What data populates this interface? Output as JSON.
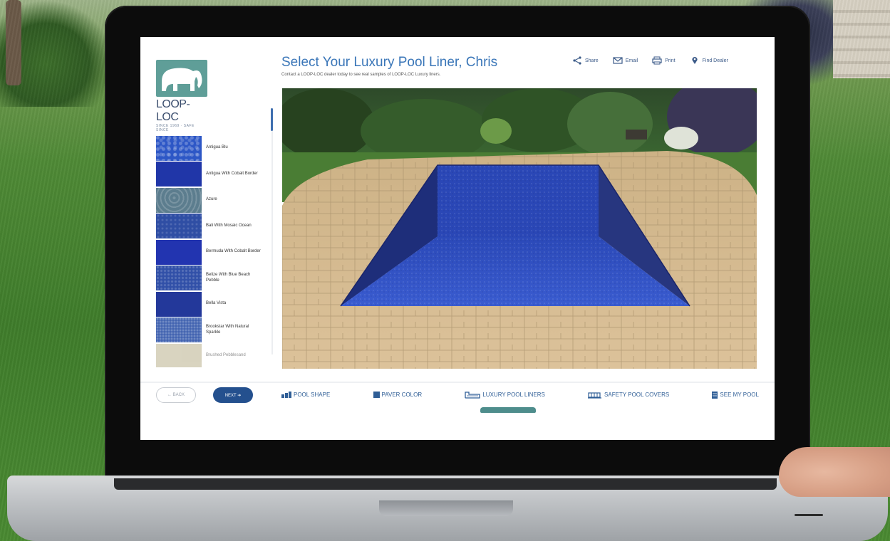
{
  "brand": {
    "name": "LOOP-LOC",
    "tagline": "SINCE 1969 · SAFE SINCE",
    "color": "#5f9e98"
  },
  "header": {
    "title": "Select Your Luxury Pool Liner, Chris",
    "subtitle": "Contact a LOOP-LOC dealer today to see real samples of LOOP-LOC Luxury liners."
  },
  "top_actions": [
    {
      "label": "Share",
      "icon": "share-icon"
    },
    {
      "label": "Email",
      "icon": "envelope-icon"
    },
    {
      "label": "Print",
      "icon": "printer-icon"
    },
    {
      "label": "Find Dealer",
      "icon": "map-pin-icon"
    }
  ],
  "liners": [
    {
      "label": "Antigua Blu",
      "color": "#2d57c6"
    },
    {
      "label": "Antigua With Cobalt Border",
      "color": "#2036a8"
    },
    {
      "label": "Azure",
      "color": "#5c7d8e"
    },
    {
      "label": "Bali With Mosaic Ocean",
      "color": "#2f4ea4"
    },
    {
      "label": "Bermuda With Cobalt Border",
      "color": "#2234b0"
    },
    {
      "label": "Belize With Blue Beach Pebble",
      "color": "#3150a8"
    },
    {
      "label": "Bella Vista",
      "color": "#23389a"
    },
    {
      "label": "Brookstar With Natural Sparkle",
      "color": "#4163b0"
    },
    {
      "label": "Brushed Pebblesand",
      "color": "#b9b08c"
    }
  ],
  "nav": {
    "back_label": "← BACK",
    "next_label": "NEXT ➔",
    "steps": [
      {
        "label": "POOL SHAPE",
        "icon": "pool-shape-icon"
      },
      {
        "label": "PAVER COLOR",
        "icon": "paver-icon"
      },
      {
        "label": "LUXURY POOL LINERS",
        "icon": "liner-icon",
        "active": true
      },
      {
        "label": "SAFETY POOL COVERS",
        "icon": "cover-icon"
      },
      {
        "label": "SEE MY POOL",
        "icon": "see-pool-icon"
      }
    ]
  },
  "colors": {
    "accent": "#3a76b8",
    "nav_text": "#2f5e96",
    "next_button": "#24508e",
    "active_tab": "#4e8d8c",
    "liner_selected": "#2d4fc0",
    "paver": "#d8bd92"
  }
}
